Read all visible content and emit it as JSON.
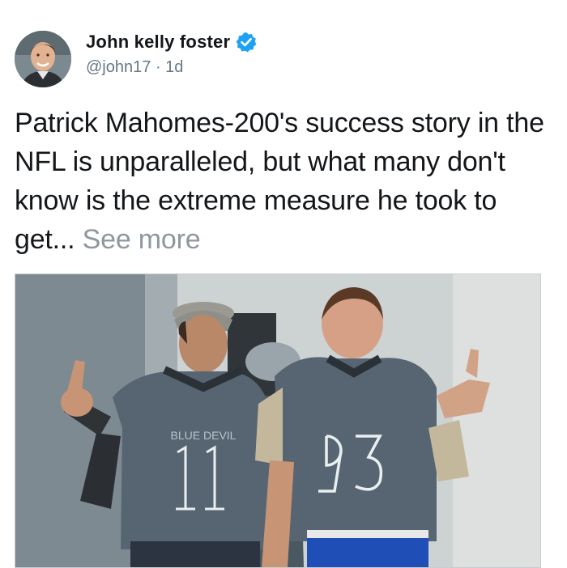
{
  "author": {
    "display_name": "John kelly foster",
    "handle": "@john17",
    "separator": "·",
    "time_ago": "1d",
    "avatar_icon": "avatar-photo",
    "verified_icon": "verified-badge-icon",
    "verified_color": "#1da1f2"
  },
  "tweet": {
    "text": "Patrick Mahomes-200's success story in the NFL is unparalleled, but what many don't know is the extreme measure he took to get... ",
    "see_more": "See more"
  },
  "photo": {
    "description_icon": "two-football-players-photo",
    "jersey_left": "11",
    "jersey_right": "93"
  }
}
